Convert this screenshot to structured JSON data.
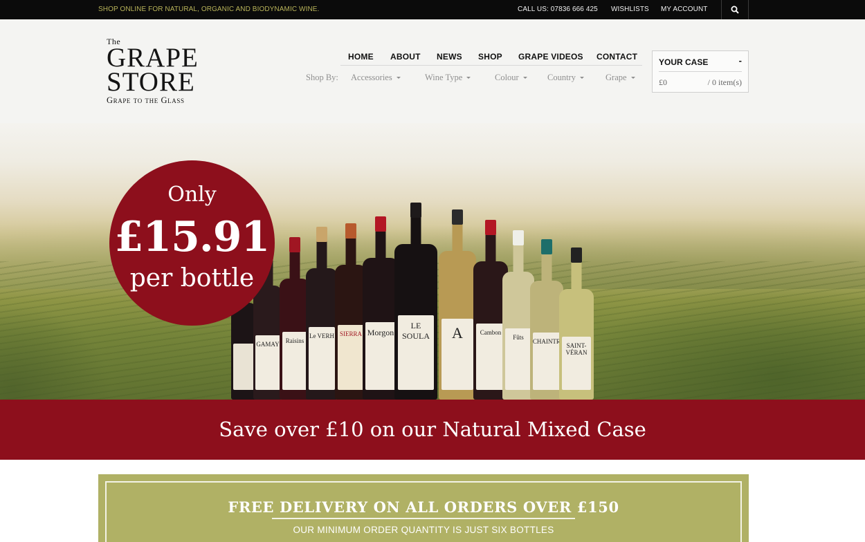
{
  "topbar": {
    "tagline": "SHOP ONLINE FOR NATURAL, ORGANIC AND BIODYNAMIC WINE.",
    "call": "CALL US: 07836 666 425",
    "wishlists": "WISHLISTS",
    "account": "MY ACCOUNT",
    "search_icon": "search-icon"
  },
  "logo": {
    "the": "The",
    "line1": "GRAPE",
    "line2": "STORE",
    "sub": "Grape to the Glass"
  },
  "nav": {
    "items": [
      "HOME",
      "ABOUT",
      "NEWS",
      "SHOP",
      "GRAPE VIDEOS",
      "CONTACT"
    ]
  },
  "shopby": {
    "label": "Shop By:",
    "menus": [
      "Accessories",
      "Wine Type",
      "Colour",
      "Country",
      "Grape"
    ]
  },
  "cart": {
    "title": "YOUR CASE",
    "toggle": "-",
    "total": "£0",
    "count": "/ 0 item(s)"
  },
  "hero": {
    "only": "Only",
    "price": "£15.91",
    "per": "per bottle",
    "bottle_labels": [
      "",
      "GAMAY",
      "Raisins",
      "Le VERH",
      "SIERRA",
      "Morgon",
      "LE SOULA",
      "A",
      "Cambon",
      "Fûts",
      "CHAINTRE",
      "SAINT-VÉRAN"
    ]
  },
  "promo": {
    "text": "Save over £10 on our Natural Mixed Case"
  },
  "delivery": {
    "heading": "FREE DELIVERY ON ALL ORDERS OVER £150",
    "subline": "OUR MINIMUM ORDER QUANTITY IS JUST SIX BOTTLES"
  },
  "colors": {
    "accent_red": "#8d0f1c",
    "olive": "#b0b165",
    "topbar": "#0b0b0b",
    "tagline": "#b9b45a"
  }
}
